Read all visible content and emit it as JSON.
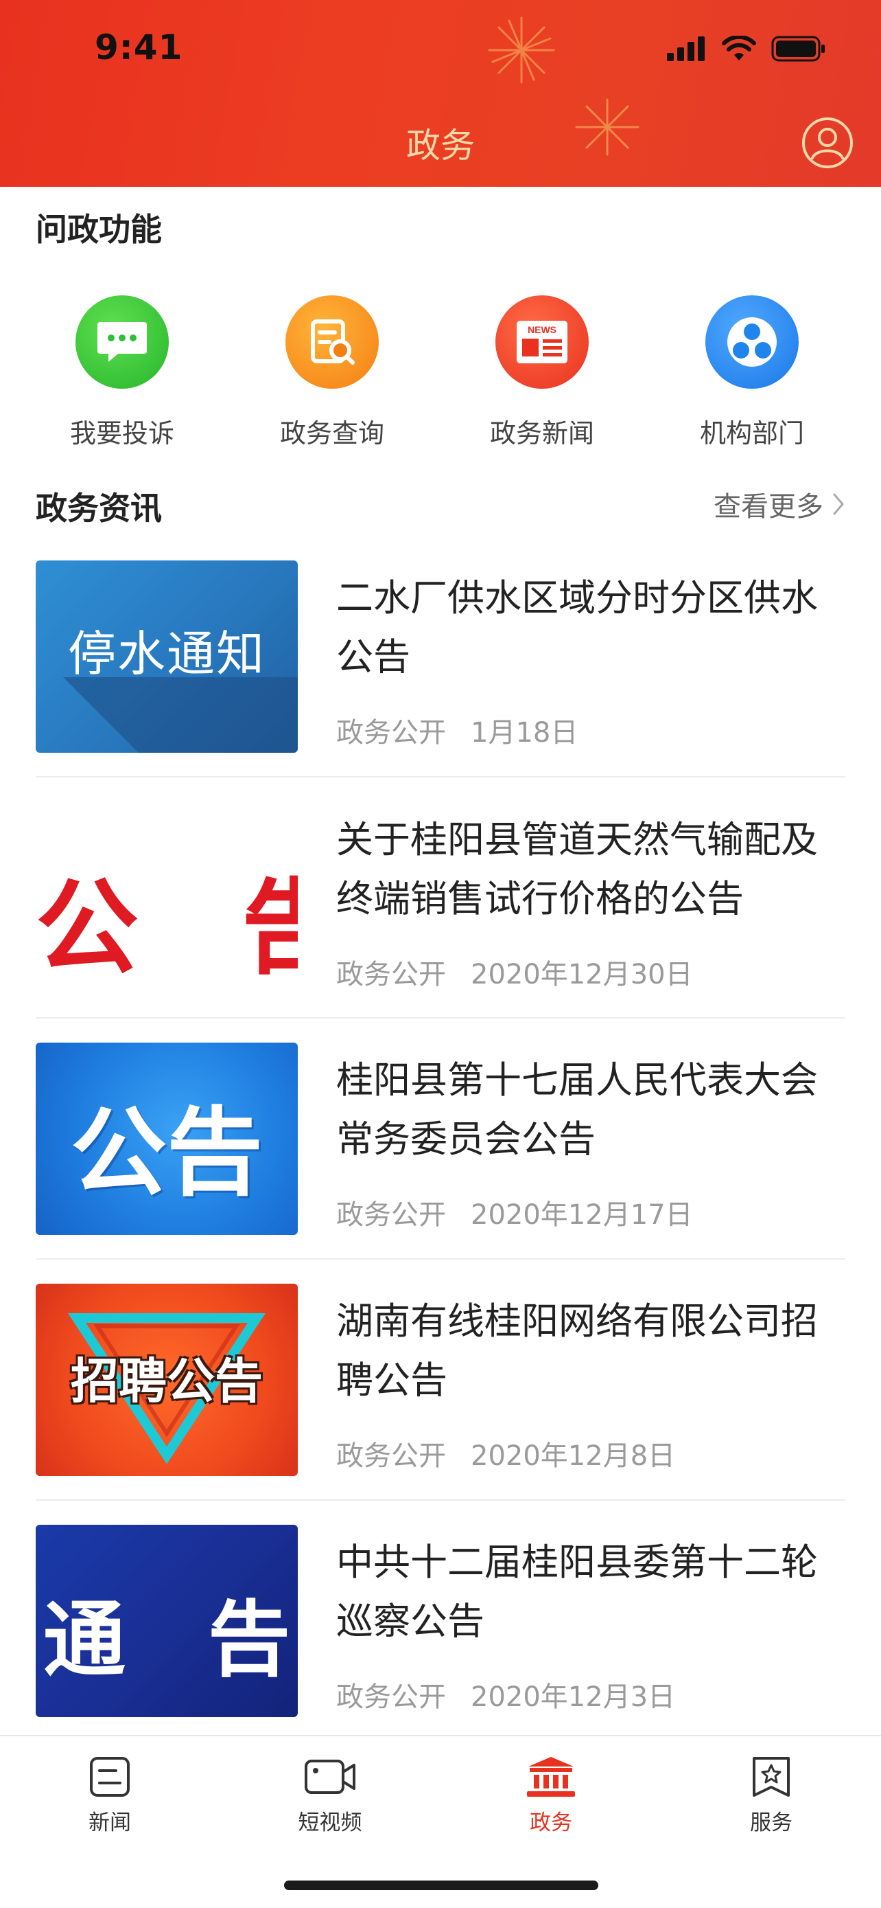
{
  "status_bar": {
    "time": "9:41"
  },
  "header": {
    "title": "政务"
  },
  "features_section": {
    "title": "问政功能",
    "items": [
      {
        "label": "我要投诉",
        "icon": "chat-bubble-icon",
        "color": "#2fc03a"
      },
      {
        "label": "政务查询",
        "icon": "document-search-icon",
        "color": "#f7891a"
      },
      {
        "label": "政务新闻",
        "icon": "news-icon",
        "color": "#ee3a2a"
      },
      {
        "label": "机构部门",
        "icon": "organization-icon",
        "color": "#1f84ec"
      }
    ]
  },
  "news_section": {
    "title": "政务资讯",
    "more_label": "查看更多",
    "items": [
      {
        "title": "二水厂供水区域分时分区供水公告",
        "source": "政务公开",
        "date": "1月18日",
        "thumb_text": "停水通知"
      },
      {
        "title": "关于桂阳县管道天然气输配及终端销售试行价格的公告",
        "source": "政务公开",
        "date": "2020年12月30日",
        "thumb_text": "公　告"
      },
      {
        "title": "桂阳县第十七届人民代表大会常务委员会公告",
        "source": "政务公开",
        "date": "2020年12月17日",
        "thumb_text": "公告"
      },
      {
        "title": "湖南有线桂阳网络有限公司招聘公告",
        "source": "政务公开",
        "date": "2020年12月8日",
        "thumb_text": "招聘公告"
      },
      {
        "title": "中共十二届桂阳县委第十二轮巡察公告",
        "source": "政务公开",
        "date": "2020年12月3日",
        "thumb_text": "通　告"
      }
    ]
  },
  "tabbar": {
    "items": [
      {
        "label": "新闻",
        "icon": "news-tab-icon"
      },
      {
        "label": "短视频",
        "icon": "video-camera-icon"
      },
      {
        "label": "政务",
        "icon": "government-building-icon",
        "active": true
      },
      {
        "label": "服务",
        "icon": "service-star-icon"
      }
    ],
    "active_color": "#e8321f"
  },
  "theme": {
    "header_color": "#e8321f",
    "header_title_color": "#f6d9a8"
  }
}
